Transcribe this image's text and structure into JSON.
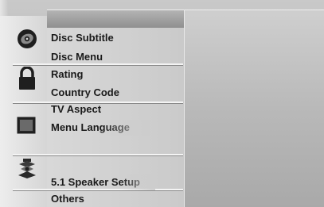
{
  "menu": {
    "groups": [
      {
        "icon": "disc-icon",
        "items": [
          {
            "label": "Disc Subtitle"
          },
          {
            "label": "Disc Menu"
          }
        ]
      },
      {
        "icon": "padlock-icon",
        "items": [
          {
            "label": "Rating"
          },
          {
            "label": "Country Code"
          }
        ]
      },
      {
        "icon": "tv-screen-icon",
        "items": [
          {
            "label": "TV Aspect"
          },
          {
            "label": "Menu Language"
          }
        ]
      },
      {
        "icon": "speaker-icon",
        "items": [
          {
            "label": "5.1 Speaker Setup"
          }
        ]
      },
      {
        "icon": "",
        "items": [
          {
            "label": "Others"
          }
        ]
      }
    ]
  }
}
